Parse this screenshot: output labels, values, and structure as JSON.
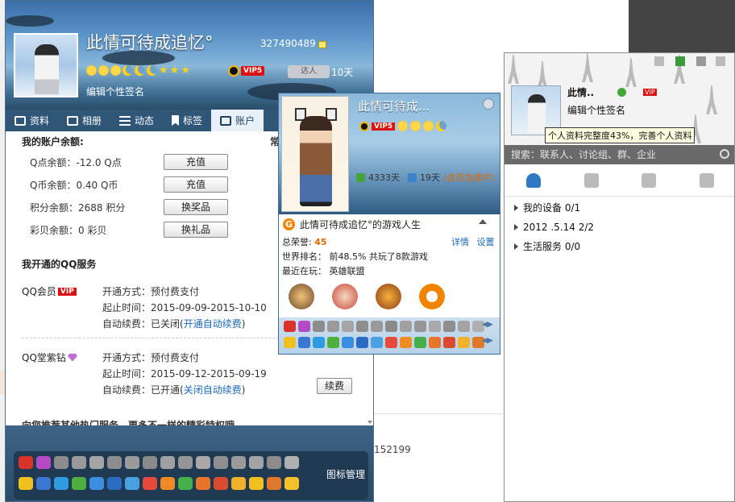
{
  "profile": {
    "nickname": "此情可待成追忆°",
    "qq_number": "327490489",
    "signature": "编辑个性签名",
    "vip_level": "VIP5",
    "daren_label": "达人",
    "online_days": "10天",
    "tabs": [
      {
        "label": "资料"
      },
      {
        "label": "相册"
      },
      {
        "label": "动态"
      },
      {
        "label": "标签"
      },
      {
        "label": "账户"
      }
    ]
  },
  "account": {
    "section_title": "我的账户余额:",
    "right_hint": "常",
    "balances": [
      {
        "label": "Q点余额：-12.0 Q点",
        "button": "充值"
      },
      {
        "label": "Q币余额：0.40 Q币",
        "button": "充值"
      },
      {
        "label": "积分余额：2688 积分",
        "button": "换奖品"
      },
      {
        "label": "彩贝余额：0 彩贝",
        "button": "换礼品"
      }
    ],
    "services_title": "我开通的QQ服务",
    "services": [
      {
        "name": "QQ会员",
        "badge": "VIP",
        "mode": "开通方式：预付费支付",
        "period": "起止时间：2015-09-09-2015-10-10",
        "renew_prefix": "自动续费：已关闭(",
        "renew_link": "开通自动续费",
        "renew_suffix": ")"
      },
      {
        "name": "QQ堂紫钻",
        "mode": "开通方式：预付费支付",
        "period": "起止时间：2015-09-12-2015-09-19",
        "renew_prefix": "自动续费：已开通(",
        "renew_link": "关闭自动续费",
        "renew_suffix": ")",
        "button": "续费"
      }
    ],
    "cut_text": "向您推荐其他热门服务，更多不一样的精彩特权哦"
  },
  "footer": {
    "icon_manager": "图标管理"
  },
  "game_card": {
    "name": "此情可待成...",
    "vip_level": "VIP5",
    "days_total": "4333天",
    "days_speed": "19天",
    "speed_text": "(会员加速中)",
    "life_title": "此情可待成追忆°的游戏人生",
    "honor_label": "总荣誉:",
    "honor_value": "45",
    "rank_text": "世界排名： 前48.5%  共玩了8款游戏",
    "recent_text": "最近在玩： 英雄联盟",
    "link_detail": "详情",
    "link_settings": "设置"
  },
  "right_panel": {
    "name": "此情..",
    "signature": "编辑个性签名",
    "tooltip": "个人资料完整度43%，完善个人资料",
    "search_placeholder": "搜索：联系人、讨论组、群、企业",
    "groups": [
      {
        "label": "我的设备 0/1"
      },
      {
        "label": "2012 .5.14 2/2"
      },
      {
        "label": "生活服务 0/0"
      }
    ]
  },
  "background": {
    "number_text": "152199"
  },
  "colors": {
    "tab_bar": "#2f5577",
    "link": "#1b69b8",
    "vip_red": "#d11111",
    "accent_orange": "#e06a00"
  }
}
